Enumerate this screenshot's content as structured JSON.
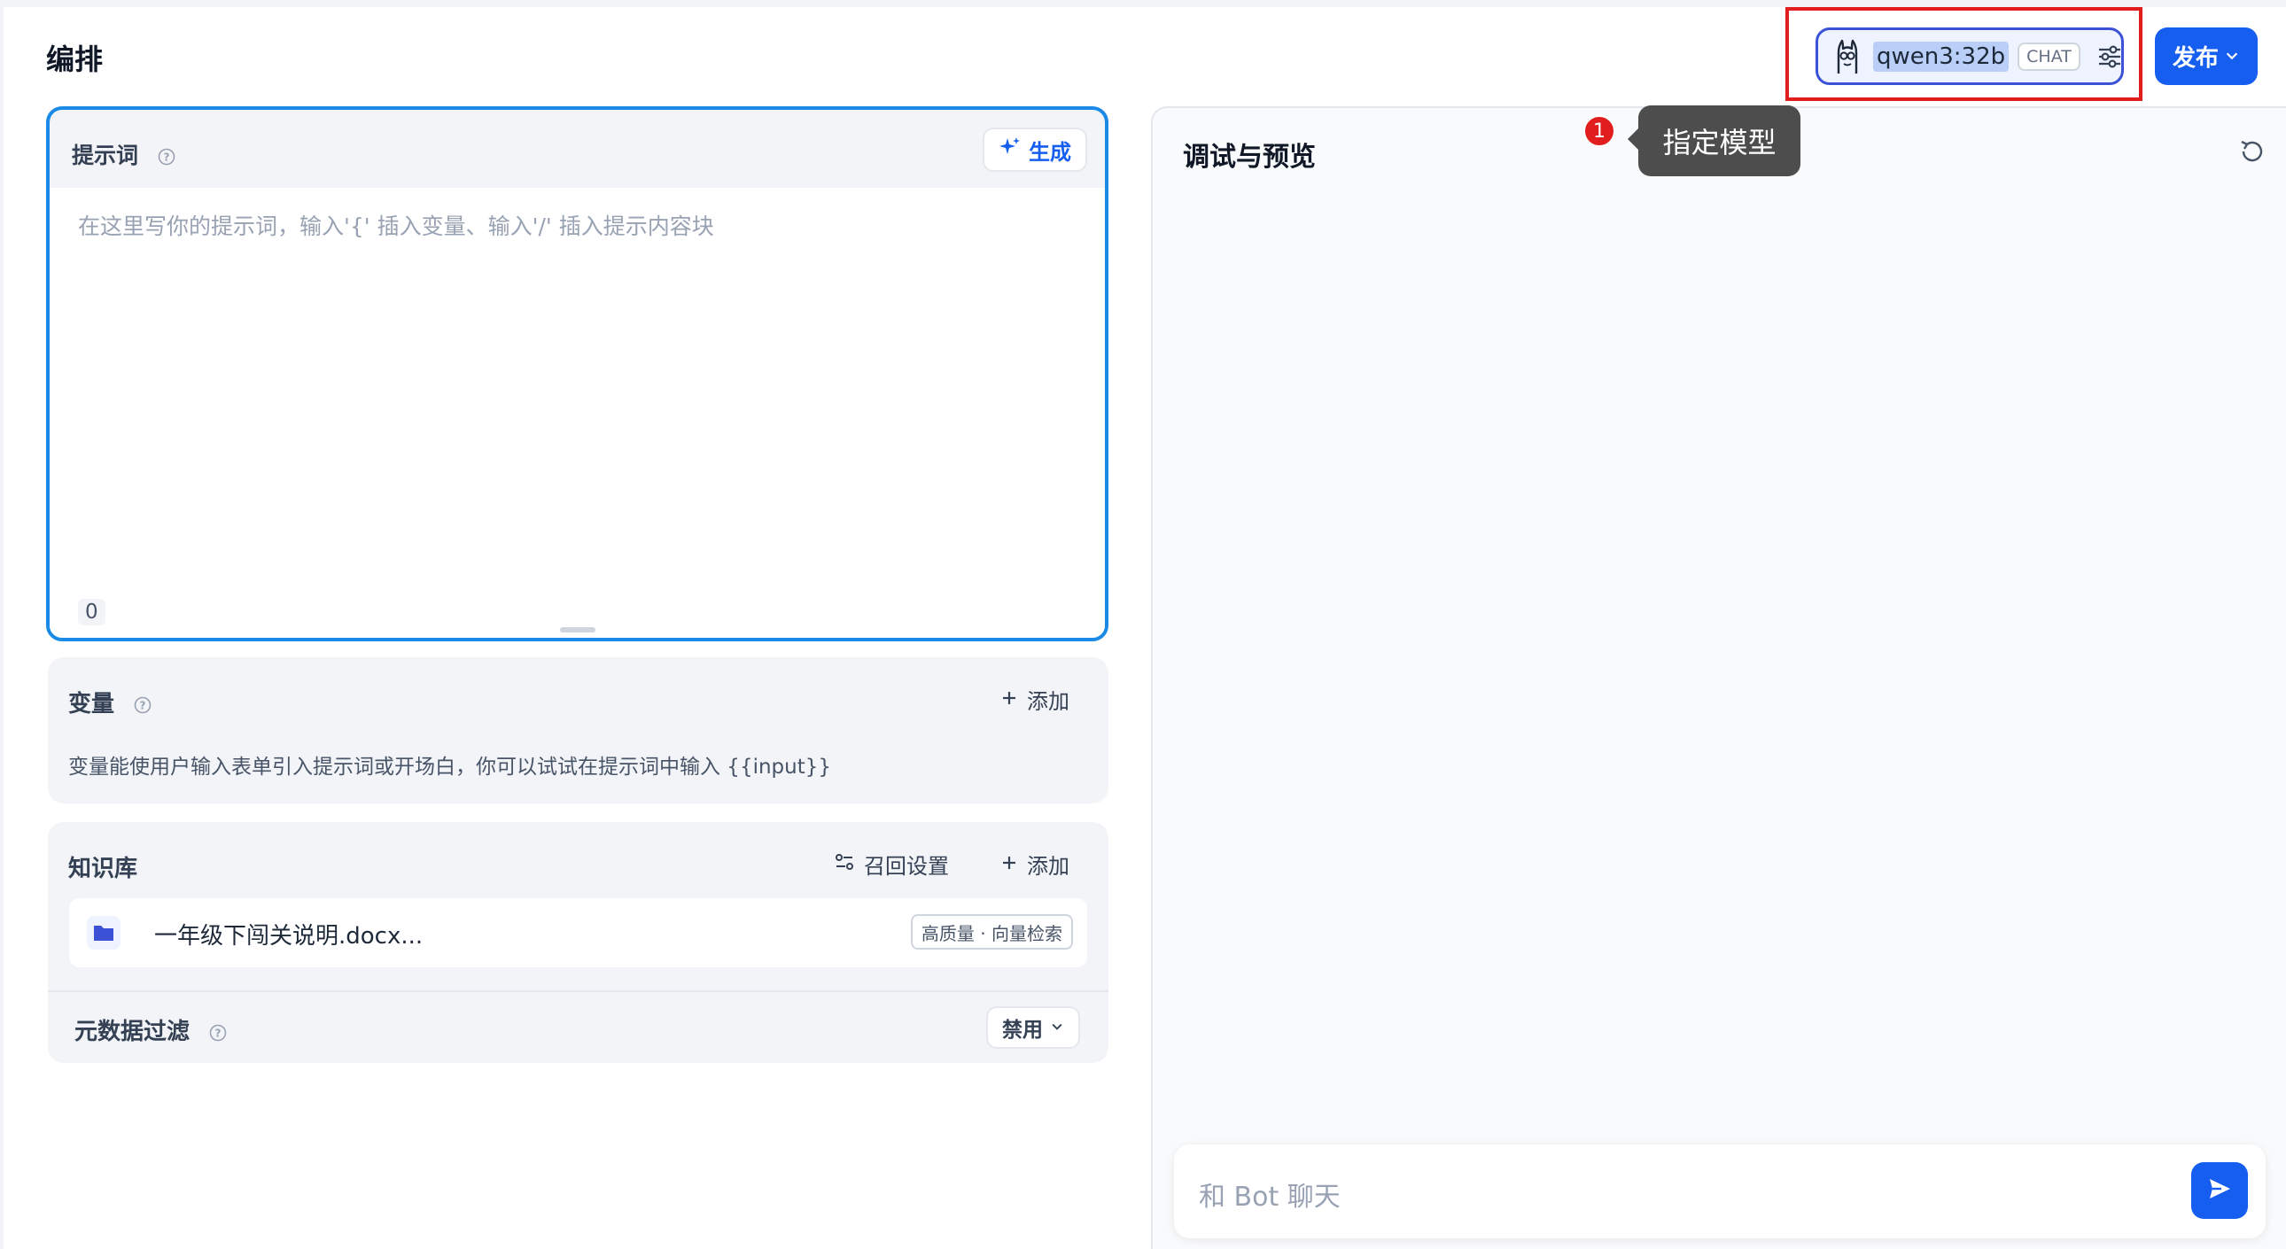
{
  "header": {
    "title": "编排",
    "model": {
      "name": "qwen3:32b",
      "mode_tag": "CHAT",
      "icon": "llama-icon",
      "settings_icon": "sliders-icon"
    },
    "publish_label": "发布"
  },
  "annotation": {
    "step": "1",
    "tooltip": "指定模型"
  },
  "prompt": {
    "label": "提示词",
    "generate_label": "生成",
    "placeholder": "在这里写你的提示词，输入'{' 插入变量、输入'/' 插入提示内容块",
    "char_count": "0"
  },
  "variables": {
    "title": "变量",
    "add_label": "添加",
    "description": "变量能使用户输入表单引入提示词或开场白，你可以试试在提示词中输入 {{input}}"
  },
  "knowledge": {
    "title": "知识库",
    "recall_label": "召回设置",
    "add_label": "添加",
    "items": [
      {
        "name": "一年级下闯关说明.docx...",
        "tag": "高质量 · 向量检索"
      }
    ],
    "metadata_filter_label": "元数据过滤",
    "metadata_filter_value": "禁用"
  },
  "preview": {
    "title": "调试与预览",
    "chat_placeholder": "和 Bot 聊天"
  },
  "colors": {
    "accent": "#155eef",
    "focus_border": "#1a8ae6",
    "highlight_red": "#e11d1d"
  }
}
